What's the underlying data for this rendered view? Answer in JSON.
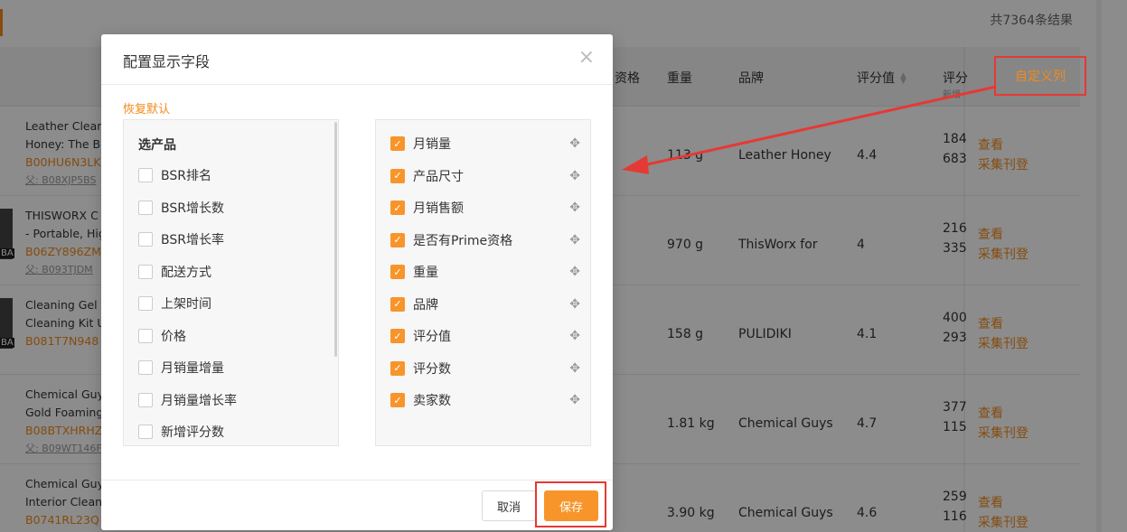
{
  "page": {
    "result_count": "共7364条结果",
    "custom_columns_button": "自定义列",
    "headers": {
      "qualification": "资格",
      "weight": "重量",
      "brand": "品牌",
      "rating": "评分值",
      "review": "评分",
      "review_sub": "新增"
    },
    "rows": [
      {
        "name1": "Leather Cleaner",
        "name2": "Honey: The Be",
        "asin": "B00HU6N3LK",
        "parent": "父: B08XJP5BS",
        "weight": "113 g",
        "brand": "Leather Honey",
        "rating": "4.4",
        "r1": "184",
        "r2": "683",
        "view": "查看",
        "collect": "采集刊登"
      },
      {
        "name1": "THISWORX C",
        "name2": "- Portable, Hig",
        "asin": "B06ZY896ZM",
        "parent": "父: B093TJDM",
        "weight": "970 g",
        "brand": "ThisWorx for",
        "rating": "4",
        "r1": "216",
        "r2": "335",
        "view": "查看",
        "collect": "采集刊登",
        "badge": "BA"
      },
      {
        "name1": "Cleaning Gel f",
        "name2": "Cleaning Kit U",
        "asin": "B081T7N948",
        "parent": "",
        "weight": "158 g",
        "brand": "PULIDIKI",
        "rating": "4.1",
        "r1": "400",
        "r2": "293",
        "view": "查看",
        "collect": "采集刊登",
        "badge": "BA"
      },
      {
        "name1": "Chemical Guys",
        "name2": "Gold Foaming",
        "asin": "B08BTXHRHZ",
        "parent": "父: B09WT146F",
        "weight": "1.81 kg",
        "brand": "Chemical Guys",
        "rating": "4.7",
        "r1": "377",
        "r2": "115",
        "view": "查看",
        "collect": "采集刊登"
      },
      {
        "name1": "Chemical Guys",
        "name2": "Interior Cleane",
        "asin": "B0741RL23Q",
        "parent": "",
        "weight": "3.90 kg",
        "brand": "Chemical Guys",
        "rating": "4.6",
        "r1": "259",
        "r2": "116",
        "view": "查看",
        "collect": "采集刊登"
      }
    ]
  },
  "modal": {
    "title": "配置显示字段",
    "close_icon": "close-icon",
    "restore_default": "恢复默认",
    "left_group_title": "选产品",
    "available_fields": [
      "BSR排名",
      "BSR增长数",
      "BSR增长率",
      "配送方式",
      "上架时间",
      "价格",
      "月销量增量",
      "月销量增长率",
      "新增评分数"
    ],
    "selected_fields": [
      "月销量",
      "产品尺寸",
      "月销售额",
      "是否有Prime资格",
      "重量",
      "品牌",
      "评分值",
      "评分数",
      "卖家数"
    ],
    "cancel_label": "取消",
    "save_label": "保存"
  },
  "colors": {
    "accent": "#f7952b",
    "highlight": "#e53935",
    "link": "#f28a1c"
  }
}
